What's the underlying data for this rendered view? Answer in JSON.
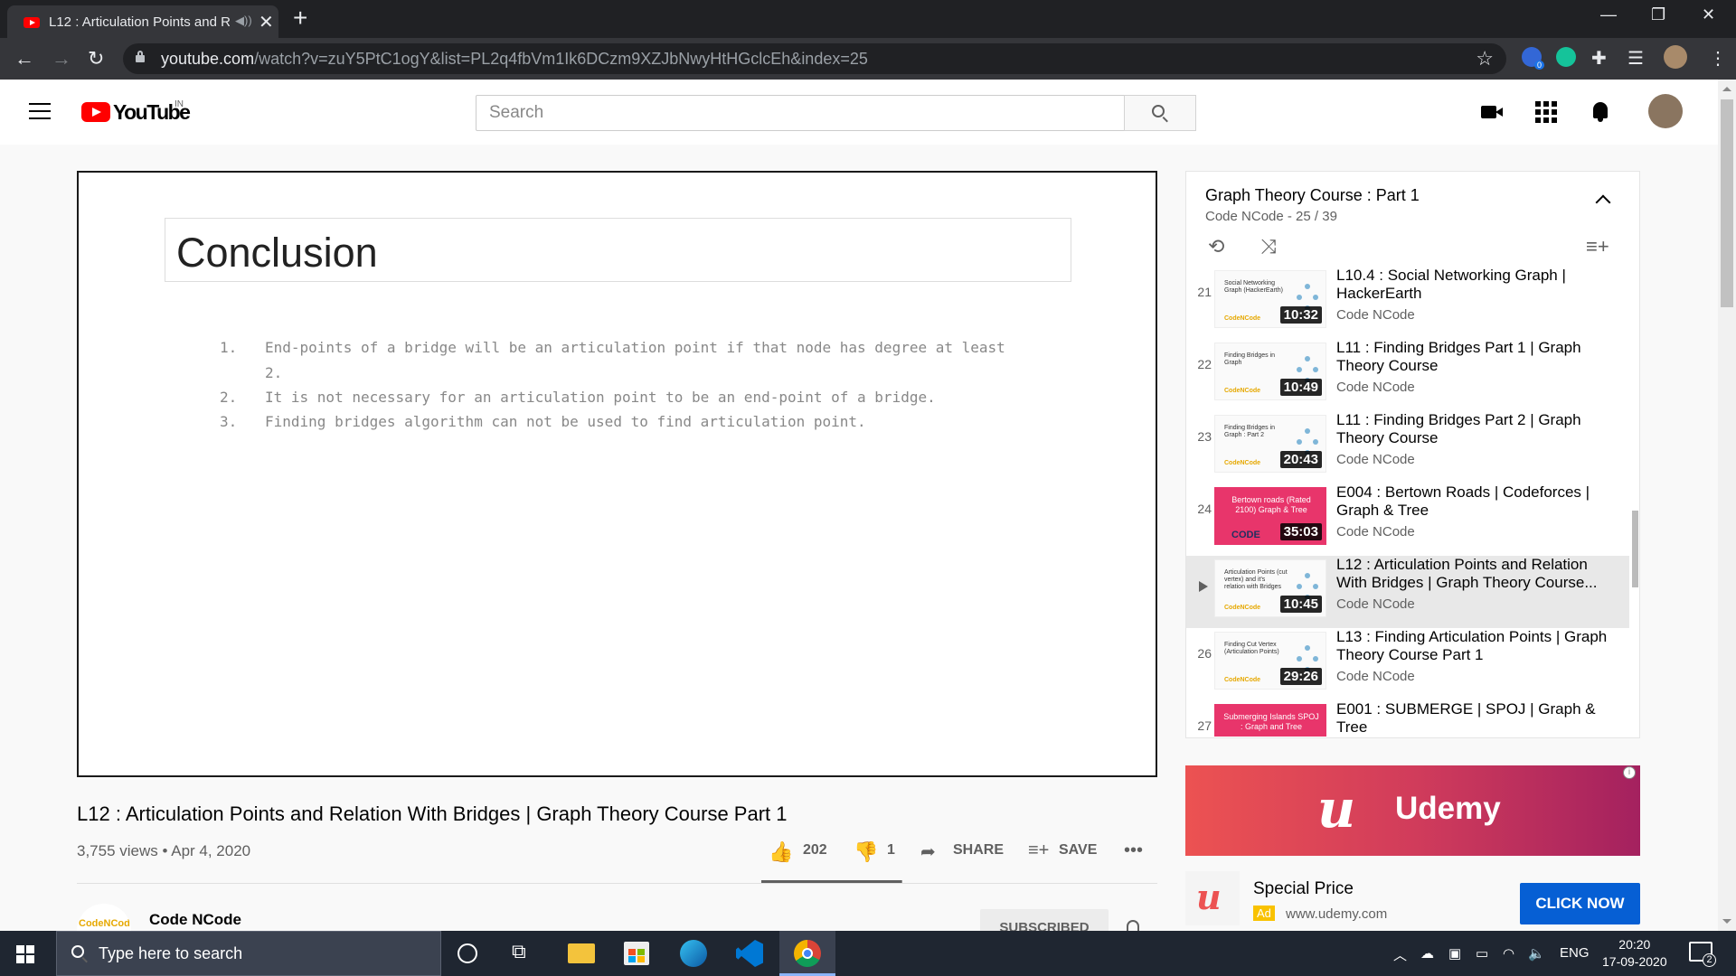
{
  "browser": {
    "tab_title": "L12 : Articulation Points and Relation With Bridges | Graph Theory Course Part 1",
    "url_host": "youtube.com",
    "url_path": "/watch?v=zuY5PtC1ogY&list=PL2q4fbVm1Ik6DCzm9XZJbNwyHtHGclcEh&index=25",
    "extension_badge": "0"
  },
  "youtube": {
    "logo_text": "YouTube",
    "country_code": "IN",
    "search_placeholder": "Search"
  },
  "slide": {
    "title": "Conclusion",
    "points": [
      {
        "num": "1.",
        "text": "End-points of a bridge will be an articulation point if that node has degree at least",
        "cont": "2."
      },
      {
        "num": "2.",
        "text": "It is not necessary for an articulation point to be an end-point of a bridge."
      },
      {
        "num": "3.",
        "text": "Finding bridges algorithm can not be used to find articulation point."
      }
    ]
  },
  "video": {
    "title": "L12 : Articulation Points and Relation With Bridges | Graph Theory Course Part 1",
    "stats": "3,755 views • Apr 4, 2020",
    "likes": "202",
    "dislikes": "1",
    "share_label": "SHARE",
    "save_label": "SAVE",
    "channel": "Code NCode",
    "avatar_text": "CodeNCode",
    "subscribe_label": "SUBSCRIBED",
    "like_ratio": 0.995
  },
  "playlist": {
    "title": "Graph Theory Course : Part 1",
    "subtitle": "Code NCode - 25 / 39",
    "items": [
      {
        "index": "21",
        "title": "L10.4 : Social Networking Graph | HackerEarth",
        "channel": "Code NCode",
        "duration": "10:32",
        "thumb_text": "Social Networking Graph (HackerEarth)",
        "thumb_brand": "CodeNCode",
        "thumb_style": "light",
        "active": false
      },
      {
        "index": "22",
        "title": "L11 : Finding Bridges Part 1 | Graph Theory Course",
        "channel": "Code NCode",
        "duration": "10:49",
        "thumb_text": "Finding Bridges in Graph",
        "thumb_brand": "CodeNCode",
        "thumb_style": "light",
        "active": false
      },
      {
        "index": "23",
        "title": "L11 : Finding Bridges Part 2 | Graph Theory Course",
        "channel": "Code NCode",
        "duration": "20:43",
        "thumb_text": "Finding Bridges in Graph : Part 2",
        "thumb_brand": "CodeNCode",
        "thumb_style": "light",
        "active": false
      },
      {
        "index": "24",
        "title": "E004 : Bertown Roads | Codeforces | Graph & Tree",
        "channel": "Code NCode",
        "duration": "35:03",
        "thumb_text": "Bertown roads (Rated 2100) Graph & Tree",
        "thumb_brand": "CODE",
        "thumb_style": "pink",
        "active": false
      },
      {
        "index": "",
        "title": "L12 : Articulation Points and Relation With Bridges | Graph Theory Course...",
        "channel": "Code NCode",
        "duration": "10:45",
        "thumb_text": "Articulation Points (cut vertex) and it's relation with Bridges",
        "thumb_brand": "CodeNCode",
        "thumb_style": "light",
        "active": true
      },
      {
        "index": "26",
        "title": "L13 : Finding Articulation Points | Graph Theory Course Part 1",
        "channel": "Code NCode",
        "duration": "29:26",
        "thumb_text": "Finding Cut Vertex (Articulation Points)",
        "thumb_brand": "CodeNCode",
        "thumb_style": "light",
        "active": false
      },
      {
        "index": "27",
        "title": "E001 : SUBMERGE | SPOJ | Graph & Tree",
        "channel": "",
        "duration": "",
        "thumb_text": "Submerging Islands SPOJ : Graph and Tree",
        "thumb_brand": "",
        "thumb_style": "pink",
        "active": false
      }
    ]
  },
  "ad": {
    "banner_brand": "Udemy",
    "title": "Special Price",
    "badge": "Ad",
    "url": "www.udemy.com",
    "cta": "CLICK NOW",
    "info": "i"
  },
  "taskbar": {
    "search_placeholder": "Type here to search",
    "language": "ENG",
    "time": "20:20",
    "date": "17-09-2020",
    "notifications": "2"
  },
  "colors": {
    "youtube_red": "#ff0000",
    "udemy_red": "#ec5252",
    "cta_blue": "#065fd4",
    "codencode_gold": "#e6a800"
  }
}
